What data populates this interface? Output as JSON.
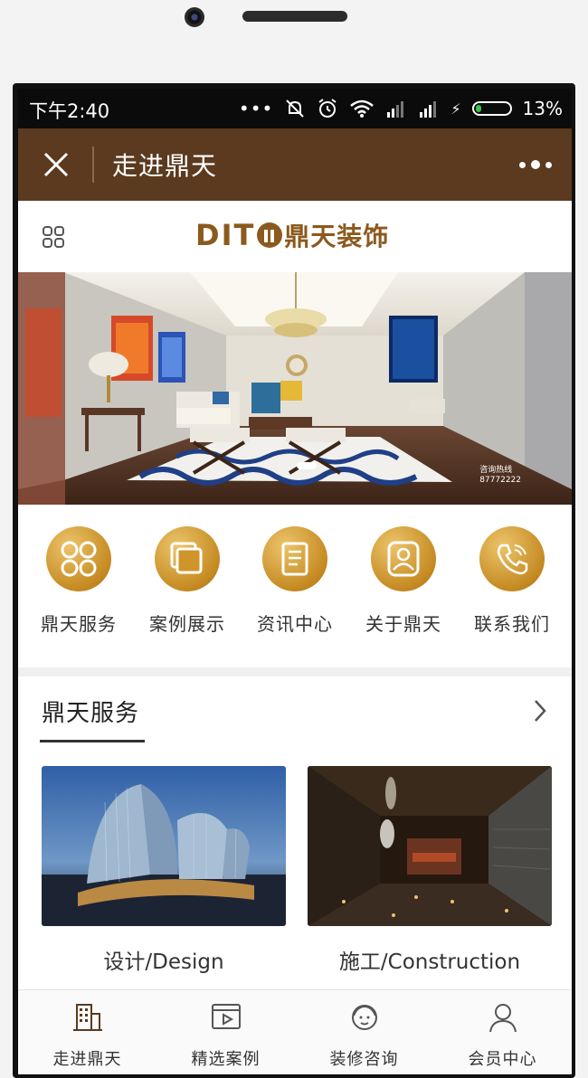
{
  "status_bar": {
    "time": "下午2:40",
    "battery_pct": "13%",
    "battery_color": "#36c24b"
  },
  "title_bar": {
    "title": "走进鼎天",
    "bg_color": "#5b3a1f"
  },
  "header": {
    "logo_latin": "DIT",
    "logo_cn": "鼎天装饰",
    "brand_color": "#8b5a1e"
  },
  "banner": {
    "hotline_label": "咨询热线",
    "hotline_number": "87772222",
    "slide_index": 1
  },
  "quick_menu": [
    {
      "label": "鼎天服务",
      "icon": "four-petal-icon"
    },
    {
      "label": "案例展示",
      "icon": "stacked-cards-icon"
    },
    {
      "label": "资讯中心",
      "icon": "document-icon"
    },
    {
      "label": "关于鼎天",
      "icon": "people-icon"
    },
    {
      "label": "联系我们",
      "icon": "phone-icon"
    }
  ],
  "service_section": {
    "title": "鼎天服务",
    "cards": [
      {
        "label": "设计/Design",
        "image": "modern-building-night"
      },
      {
        "label": "施工/Construction",
        "image": "dark-interior-hall"
      }
    ]
  },
  "tab_bar": [
    {
      "label": "走进鼎天",
      "icon": "building-icon",
      "active": true
    },
    {
      "label": "精选案例",
      "icon": "video-icon",
      "active": false
    },
    {
      "label": "装修咨询",
      "icon": "consultant-icon",
      "active": false
    },
    {
      "label": "会员中心",
      "icon": "user-icon",
      "active": false
    }
  ],
  "accent_gold": "#c58a22"
}
